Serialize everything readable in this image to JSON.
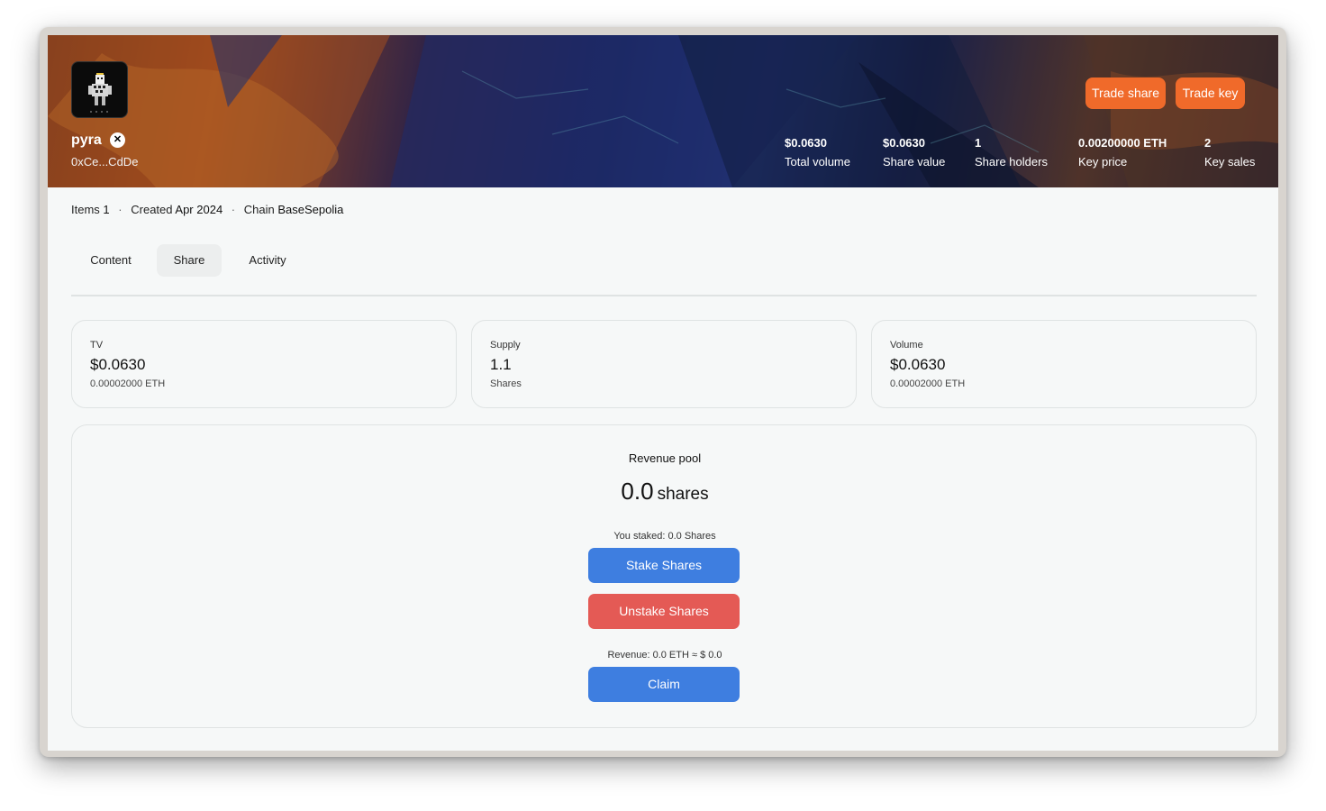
{
  "profile": {
    "name": "pyra",
    "address": "0xCe...CdDe",
    "social_icon": "x-icon"
  },
  "header_buttons": {
    "trade_share": "Trade share",
    "trade_key": "Trade key"
  },
  "stats": [
    {
      "value": "$0.0630",
      "label": "Total volume"
    },
    {
      "value": "$0.0630",
      "label": "Share value"
    },
    {
      "value": "1",
      "label": "Share holders"
    },
    {
      "value": "0.00200000 ETH",
      "label": "Key price"
    },
    {
      "value": "2",
      "label": "Key sales"
    }
  ],
  "meta": {
    "items_label": "Items",
    "items_value": "1",
    "created_label": "Created",
    "created_value": "Apr 2024",
    "chain_label": "Chain",
    "chain_value": "BaseSepolia"
  },
  "tabs": [
    {
      "label": "Content",
      "active": false
    },
    {
      "label": "Share",
      "active": true
    },
    {
      "label": "Activity",
      "active": false
    }
  ],
  "cards": [
    {
      "label": "TV",
      "value": "$0.0630",
      "sub": "0.00002000 ETH"
    },
    {
      "label": "Supply",
      "value": "1.1",
      "sub": "Shares"
    },
    {
      "label": "Volume",
      "value": "$0.0630",
      "sub": "0.00002000 ETH"
    }
  ],
  "pool": {
    "title": "Revenue pool",
    "amount": "0.0",
    "unit": "shares",
    "staked_text": "You staked: 0.0 Shares",
    "stake_button": "Stake Shares",
    "unstake_button": "Unstake Shares",
    "revenue_text": "Revenue: 0.0 ETH ≈ $ 0.0",
    "claim_button": "Claim"
  },
  "colors": {
    "accent_orange": "#f06a2a",
    "primary_blue": "#3e7ee0",
    "danger_red": "#e45a55"
  }
}
